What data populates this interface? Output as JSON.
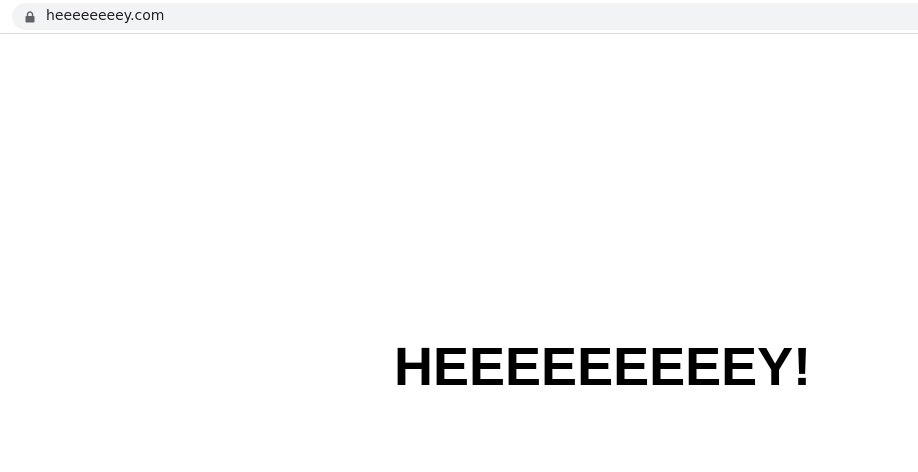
{
  "browser": {
    "url": "heeeeeeeey.com",
    "secure": true,
    "lock_icon": "lock-icon"
  },
  "page": {
    "headline": "HEEEEEEEEEY!"
  },
  "colors": {
    "address_bar_bg": "#f1f3f4",
    "url_text": "#202124",
    "lock_icon": "#5f6368",
    "headline": "#000000",
    "page_bg": "#ffffff"
  }
}
